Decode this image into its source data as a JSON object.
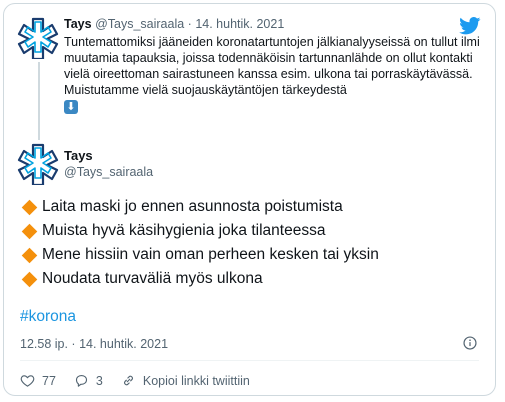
{
  "tweet1": {
    "name": "Tays",
    "handle": "@Tays_sairaala",
    "separator": "·",
    "date": "14. huhtik. 2021",
    "text": "Tuntemattomiksi jääneiden koronatartuntojen jälkianalyyseissä on tullut ilmi muutamia tapauksia, joissa todennäköisin tartunnanlähde on ollut kontakti vielä oireettoman sairastuneen kanssa esim. ulkona tai porraskäytävässä. Muistutamme vielä suojauskäytäntöjen tärkeydestä",
    "emoji": "⬇"
  },
  "tweet2": {
    "name": "Tays",
    "handle": "@Tays_sairaala",
    "bullets": [
      "Laita maski jo ennen asunnosta poistumista",
      "Muista hyvä käsihygienia joka tilanteessa",
      "Mene hissiin vain oman perheen kesken tai yksin",
      "Noudata turvaväliä myös ulkona"
    ],
    "hashtag": "#korona",
    "timestamp": "12.58 ip. · 14. huhtik. 2021",
    "likes": "77",
    "replies": "3",
    "copy_link": "Kopioi linkki twiittiin"
  },
  "colors": {
    "accent": "#1b95e0",
    "bullet": "#f4900c",
    "like": "#e0245e",
    "logo": "#1d9bf0"
  },
  "icons": [
    "twitter-bird-icon",
    "tays-logo-icon",
    "info-icon",
    "heart-icon",
    "reply-icon",
    "link-icon"
  ]
}
